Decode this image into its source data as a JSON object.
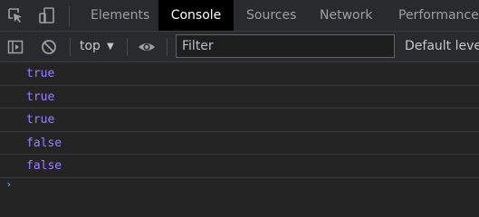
{
  "tabs": {
    "inspect_icon": "element-picker-icon",
    "device_icon": "device-toolbar-icon",
    "items": [
      {
        "label": "Elements"
      },
      {
        "label": "Console"
      },
      {
        "label": "Sources"
      },
      {
        "label": "Network"
      },
      {
        "label": "Performance"
      }
    ],
    "active": "Console"
  },
  "toolbar": {
    "sidebar_icon": "show-sidebar-icon",
    "clear_icon": "clear-console-icon",
    "context": "top",
    "live_expression_icon": "eye-icon",
    "filter_placeholder": "Filter",
    "levels_label": "Default level"
  },
  "console": {
    "rows": [
      {
        "text": "true"
      },
      {
        "text": "true"
      },
      {
        "text": "true"
      },
      {
        "text": "false"
      },
      {
        "text": "false"
      }
    ],
    "prompt_icon": "chevron-right-icon"
  },
  "colors": {
    "background": "#242424",
    "toolbar": "#292a2d",
    "active_tab": "#000000",
    "boolean_value": "#9980ff",
    "prompt": "#4aa8ff"
  }
}
